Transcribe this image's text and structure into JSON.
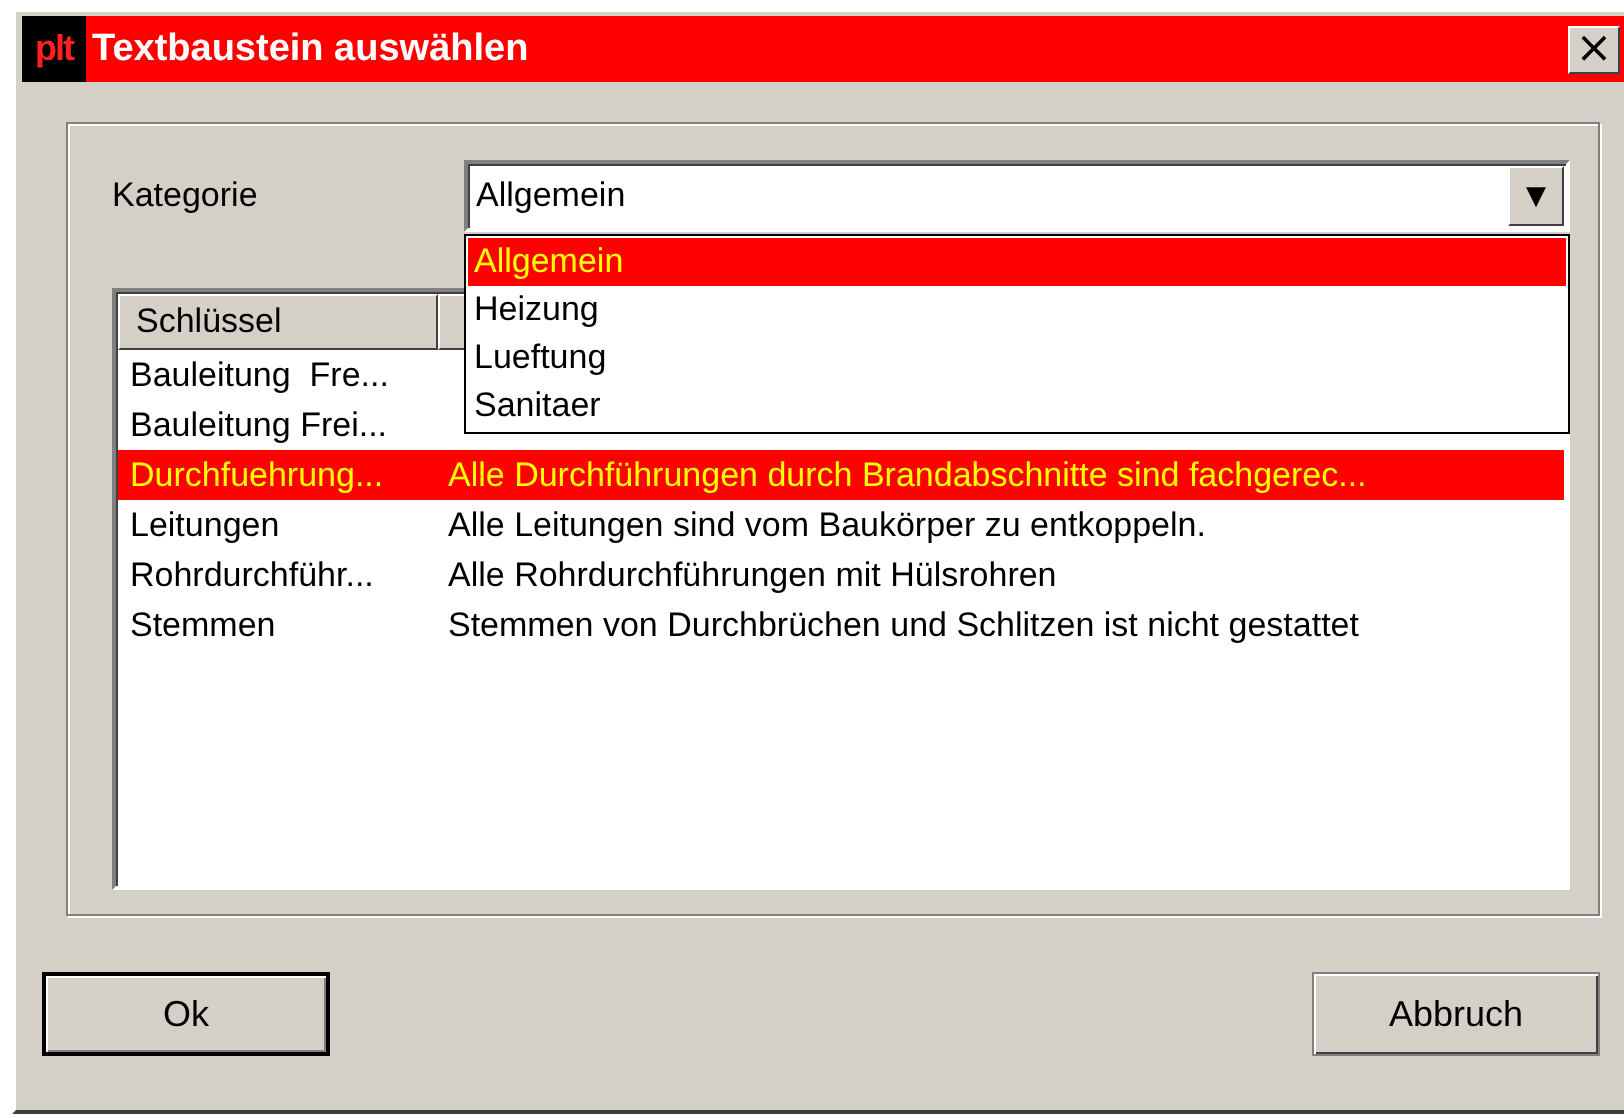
{
  "window": {
    "app_badge": "plt",
    "title": "Textbaustein auswählen",
    "close": "×"
  },
  "category": {
    "label": "Kategorie",
    "value": "Allgemein",
    "arrow": "▼",
    "expanded": true,
    "options": [
      {
        "label": "Allgemein",
        "selected": true
      },
      {
        "label": "Heizung",
        "selected": false
      },
      {
        "label": "Lueftung",
        "selected": false
      },
      {
        "label": "Sanitaer",
        "selected": false
      }
    ]
  },
  "table": {
    "columns": [
      "Schlüssel"
    ],
    "rows": [
      {
        "key": "Bauleitung  Fre...",
        "selected": false
      },
      {
        "key": "Bauleitung Frei...",
        "selected": false
      },
      {
        "key": "Durchfuehrung...",
        "text": "Alle Durchführungen durch Brandabschnitte sind fachgerec...",
        "selected": true
      },
      {
        "key": "Leitungen",
        "text": "Alle Leitungen sind vom Baukörper zu entkoppeln.",
        "selected": false
      },
      {
        "key": "Rohrdurchführ...",
        "text": "Alle Rohrdurchführungen mit Hülsrohren",
        "selected": false
      },
      {
        "key": "Stemmen",
        "text": "Stemmen von Durchbrüchen und Schlitzen ist nicht gestattet",
        "selected": false
      }
    ]
  },
  "buttons": [
    {
      "label": "Ok",
      "default": true
    },
    {
      "label": "Abbruch",
      "default": false
    }
  ]
}
